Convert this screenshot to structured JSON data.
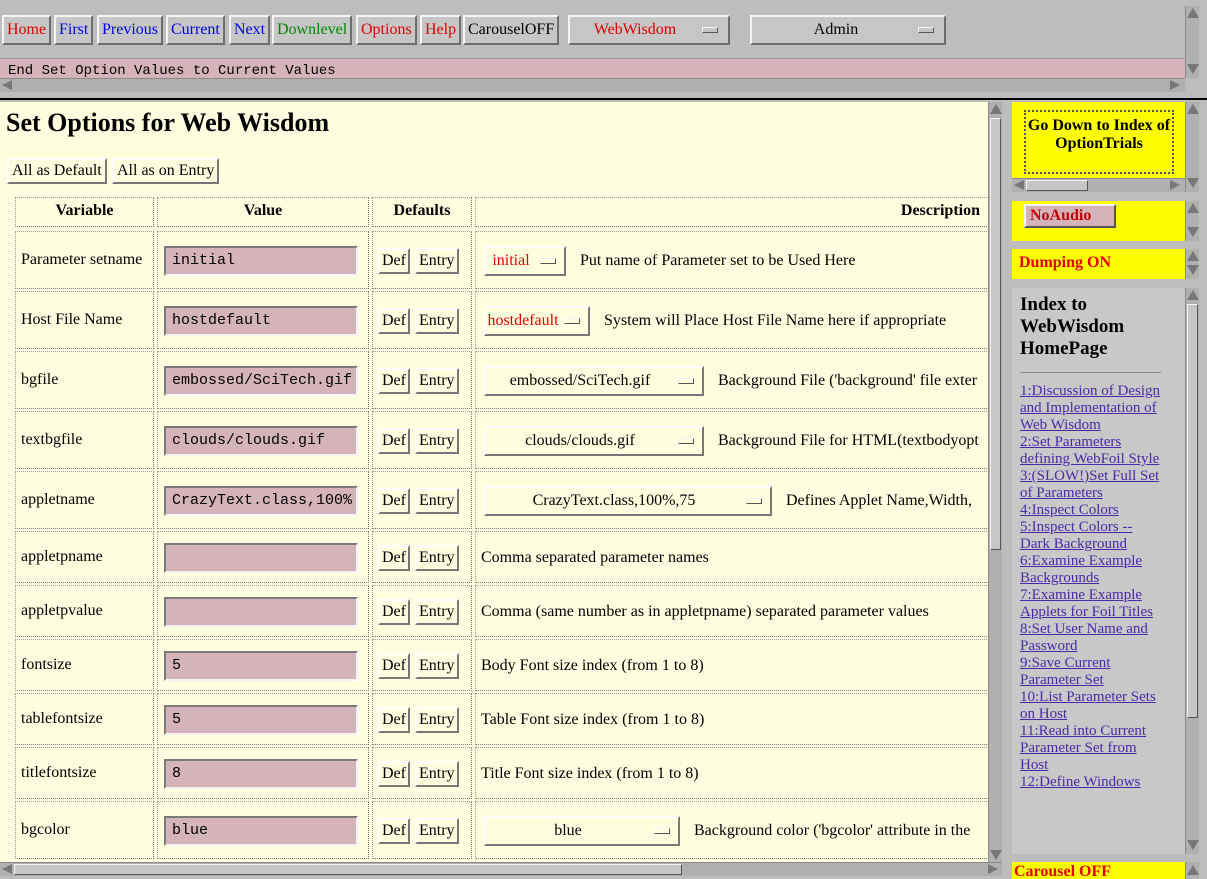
{
  "nav": {
    "buttons": [
      {
        "label": "Home",
        "color": "#e00000"
      },
      {
        "label": "First",
        "color": "#0000e8"
      },
      {
        "label": "Previous",
        "color": "#0000e8"
      },
      {
        "label": "Current",
        "color": "#0000e8"
      },
      {
        "label": "Next",
        "color": "#0000e8"
      },
      {
        "label": "Downlevel",
        "color": "#008a00"
      },
      {
        "label": "Options",
        "color": "#e00000"
      },
      {
        "label": "Help",
        "color": "#e00000"
      },
      {
        "label": "CarouselOFF",
        "color": "#000000"
      }
    ],
    "menu1": "WebWisdom",
    "menu2": "Admin",
    "status": "End Set Option Values to Current Values"
  },
  "main": {
    "title": "Set Options for Web Wisdom",
    "all_default": "All as Default",
    "all_entry": "All as on Entry",
    "headers": {
      "variable": "Variable",
      "value": "Value",
      "defaults": "Defaults",
      "description": "Description"
    },
    "def_label": "Def",
    "entry_label": "Entry",
    "rows": [
      {
        "name": "Parameter setname",
        "value": "initial",
        "dropdown": "initial",
        "dropdown_red": true,
        "desc": "Put name of Parameter set to be Used Here"
      },
      {
        "name": "Host File Name",
        "value": "hostdefault",
        "dropdown": "hostdefault",
        "dropdown_red": true,
        "desc": "System will Place Host File Name here if appropriate"
      },
      {
        "name": "bgfile",
        "value": "embossed/SciTech.gif",
        "dropdown": "embossed/SciTech.gif",
        "dropdown_red": false,
        "desc": "Background File ('background' file exter"
      },
      {
        "name": "textbgfile",
        "value": "clouds/clouds.gif",
        "dropdown": "clouds/clouds.gif",
        "dropdown_red": false,
        "desc": "Background File for HTML(textbodyopt"
      },
      {
        "name": "appletname",
        "value": "CrazyText.class,100%",
        "dropdown": "CrazyText.class,100%,75",
        "dropdown_red": false,
        "desc": "Defines Applet Name,Width,"
      },
      {
        "name": "appletpname",
        "value": "",
        "dropdown": "",
        "dropdown_red": false,
        "desc": "Comma separated parameter names"
      },
      {
        "name": "appletpvalue",
        "value": "",
        "dropdown": "",
        "dropdown_red": false,
        "desc": "Comma (same number as in appletpname) separated parameter values"
      },
      {
        "name": "fontsize",
        "value": "5",
        "dropdown": "",
        "dropdown_red": false,
        "desc": "Body Font size index (from 1 to 8)"
      },
      {
        "name": "tablefontsize",
        "value": "5",
        "dropdown": "",
        "dropdown_red": false,
        "desc": "Table Font size index (from 1 to 8)"
      },
      {
        "name": "titlefontsize",
        "value": "8",
        "dropdown": "",
        "dropdown_red": false,
        "desc": "Title Font size index (from 1 to 8)"
      },
      {
        "name": "bgcolor",
        "value": "blue",
        "dropdown": "blue",
        "dropdown_red": false,
        "desc": "Background color ('bgcolor' attribute in the"
      }
    ]
  },
  "side": {
    "godown": "Go Down to Index of OptionTrials",
    "noaudio": "NoAudio",
    "dumping": "Dumping ON",
    "index_title": "Index to WebWisdom HomePage",
    "links": [
      "1:Discussion of Design and Implementation of Web Wisdom",
      "2:Set Parameters defining WebFoil Style",
      "3:(SLOW!)Set Full Set of Parameters",
      "4:Inspect Colors",
      "5:Inspect Colors -- Dark Background",
      "6:Examine Example Backgrounds",
      "7:Examine Example Applets for Foil Titles",
      "8:Set User Name and Password",
      "9:Save Current Parameter Set",
      "10:List Parameter Sets on Host",
      "11:Read into Current Parameter Set from Host",
      "12:Define Windows"
    ],
    "carousel": "Carousel OFF"
  }
}
